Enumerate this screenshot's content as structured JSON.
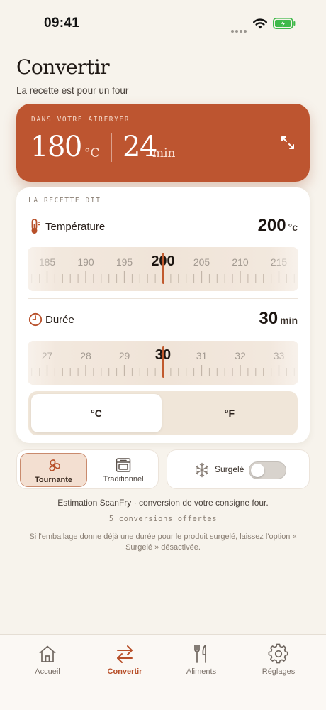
{
  "status_bar": {
    "time": "09:41"
  },
  "header": {
    "title": "Convertir",
    "subtitle": "La recette est pour un four"
  },
  "airfryer": {
    "label": "DANS VOTRE AIRFRYER",
    "temperature": "180",
    "temperature_unit": "°C",
    "time": "24",
    "time_unit": "min",
    "expand_icon": "expand-icon"
  },
  "recipe": {
    "label": "LA RECETTE DIT",
    "temperature": {
      "name": "Température",
      "value": "200",
      "unit": "°c",
      "icon": "thermometer-icon",
      "ruler_labels": [
        "185",
        "190",
        "195",
        "200",
        "205",
        "210",
        "215"
      ],
      "selected": "200"
    },
    "duration": {
      "name": "Durée",
      "value": "30",
      "unit": "min",
      "icon": "clock-icon",
      "ruler_labels": [
        "27",
        "28",
        "29",
        "30",
        "31",
        "32",
        "33"
      ],
      "selected": "30"
    },
    "units": {
      "celsius": "°C",
      "fahrenheit": "°F",
      "selected": "°C"
    }
  },
  "mode": {
    "options": [
      {
        "label": "Tournante",
        "icon": "fan-icon",
        "selected": true
      },
      {
        "label": "Traditionnel",
        "icon": "oven-icon",
        "selected": false
      }
    ]
  },
  "frozen": {
    "label": "Surgelé",
    "icon": "snowflake-icon",
    "enabled": false
  },
  "info": {
    "estimation": "Estimation ScanFry · conversion de votre consigne four.",
    "conversions": "5 conversions offertes",
    "note": "Si l'emballage donne déjà une durée pour le produit surgelé, laissez l'option « Surgelé » désactivée."
  },
  "tabbar": {
    "items": [
      {
        "label": "Accueil",
        "icon": "home-icon"
      },
      {
        "label": "Convertir",
        "icon": "convert-arrows-icon"
      },
      {
        "label": "Aliments",
        "icon": "fork-knife-icon"
      },
      {
        "label": "Réglages",
        "icon": "gear-icon"
      }
    ],
    "active": "Convertir"
  },
  "colors": {
    "accent": "#bd5530",
    "background": "#f7f3ec",
    "card": "#ffffff",
    "toggle_off": "#d8d3cd"
  }
}
